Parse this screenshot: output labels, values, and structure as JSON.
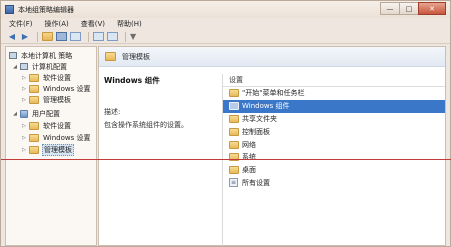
{
  "window": {
    "title": "本地组策略编辑器",
    "controls": {
      "minimize": "—",
      "maximize": "□",
      "close": "✕"
    }
  },
  "menu": [
    "文件(F)",
    "操作(A)",
    "查看(V)",
    "帮助(H)"
  ],
  "toolbar": {
    "back": "◀",
    "forward": "▶",
    "filter": "▼"
  },
  "tree": {
    "root": "本地计算机 策略",
    "computer_config": "计算机配置",
    "user_config": "用户配置",
    "computer_children": [
      "软件设置",
      "Windows 设置",
      "管理模板"
    ],
    "user_children": [
      "软件设置",
      "Windows 设置",
      "管理模板"
    ],
    "expander_open": "◢",
    "expander_closed": "▷"
  },
  "content": {
    "header_title": "管理模板",
    "description": {
      "title": "Windows 组件",
      "label": "描述:",
      "text": "包含操作系统组件的设置。"
    },
    "list": {
      "column_header": "设置",
      "items": [
        "\"开始\"菜单和任务栏",
        "Windows 组件",
        "共享文件夹",
        "控制面板",
        "网络",
        "系统",
        "桌面",
        "所有设置"
      ],
      "selected_index": 1
    }
  },
  "colors": {
    "selection": "#3b77c9",
    "annotation_line": "#c23a3a",
    "folder": "#e8b95a"
  }
}
